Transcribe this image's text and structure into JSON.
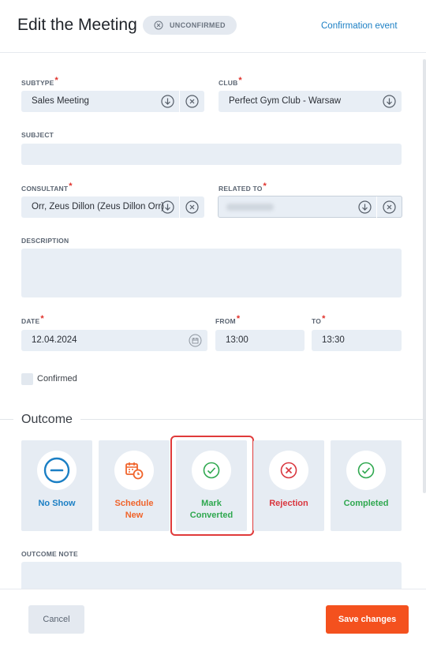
{
  "header": {
    "title": "Edit the Meeting",
    "status_badge": "UNCONFIRMED",
    "confirmation_link": "Confirmation event"
  },
  "form": {
    "subtype": {
      "label": "SUBTYPE",
      "value": "Sales Meeting"
    },
    "club": {
      "label": "CLUB",
      "value": "Perfect Gym Club - Warsaw"
    },
    "subject": {
      "label": "SUBJECT",
      "value": ""
    },
    "consultant": {
      "label": "CONSULTANT",
      "value": "Orr, Zeus Dillon (Zeus Dillon Orr)"
    },
    "related_to": {
      "label": "RELATED TO",
      "value": ""
    },
    "description": {
      "label": "DESCRIPTION",
      "value": ""
    },
    "date": {
      "label": "DATE",
      "value": "12.04.2024"
    },
    "from": {
      "label": "FROM",
      "value": "13:00"
    },
    "to": {
      "label": "TO",
      "value": "13:30"
    },
    "confirmed": {
      "label": "Confirmed",
      "checked": false
    }
  },
  "outcome": {
    "title": "Outcome",
    "options": [
      {
        "label_line1": "No Show",
        "label_line2": "",
        "color": "#1b7fc4",
        "icon": "minus-circle-icon"
      },
      {
        "label_line1": "Schedule",
        "label_line2": "New",
        "color": "#f0642b",
        "icon": "calendar-clock-icon"
      },
      {
        "label_line1": "Mark",
        "label_line2": "Converted",
        "color": "#2fa84f",
        "icon": "check-circle-icon"
      },
      {
        "label_line1": "Rejection",
        "label_line2": "",
        "color": "#d9363e",
        "icon": "x-circle-icon"
      },
      {
        "label_line1": "Completed",
        "label_line2": "",
        "color": "#2fa84f",
        "icon": "check-circle-icon"
      }
    ],
    "note_label": "OUTCOME NOTE"
  },
  "footer": {
    "cancel_label": "Cancel",
    "save_label": "Save changes"
  },
  "colors": {
    "accent_save": "#f4511e",
    "link": "#1b7fc4",
    "required": "#e0312b",
    "field_bg": "#e8eef5"
  }
}
